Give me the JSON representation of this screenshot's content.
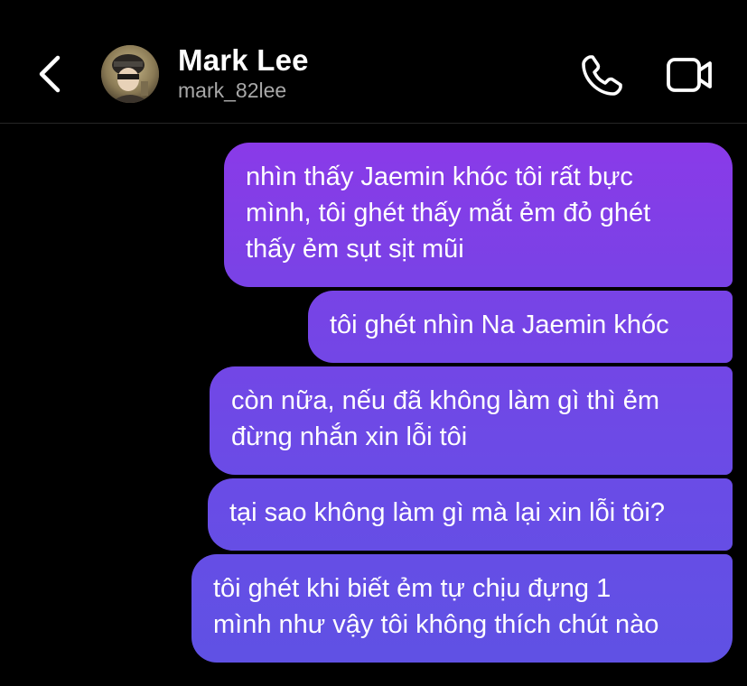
{
  "header": {
    "contact_name": "Mark Lee",
    "contact_username": "mark_82lee",
    "icons": {
      "back": "chevron-left-icon",
      "call": "phone-icon",
      "video": "video-camera-icon"
    }
  },
  "thread": {
    "messages": [
      {
        "sender": "me",
        "text": "nhìn thấy Jaemin khóc tôi rất bực\nmình, tôi ghét thấy mắt ẻm đỏ ghét\nthấy ẻm sụt sịt mũi"
      },
      {
        "sender": "me",
        "text": "tôi ghét nhìn Na Jaemin khóc"
      },
      {
        "sender": "me",
        "text": "còn nữa, nếu đã không làm gì thì ẻm\nđừng nhắn xin lỗi tôi"
      },
      {
        "sender": "me",
        "text": "tại sao không làm gì mà lại xin lỗi tôi?"
      },
      {
        "sender": "me",
        "text": "tôi ghét khi biết ẻm tự chịu đựng 1\nmình như vậy tôi không thích chút nào"
      }
    ]
  },
  "colors": {
    "background": "#000000",
    "bubble_gradient_top": "#8c39e8",
    "bubble_gradient_bottom": "#5e52e4",
    "username_gray": "#a8a8a8",
    "text": "#ffffff"
  }
}
